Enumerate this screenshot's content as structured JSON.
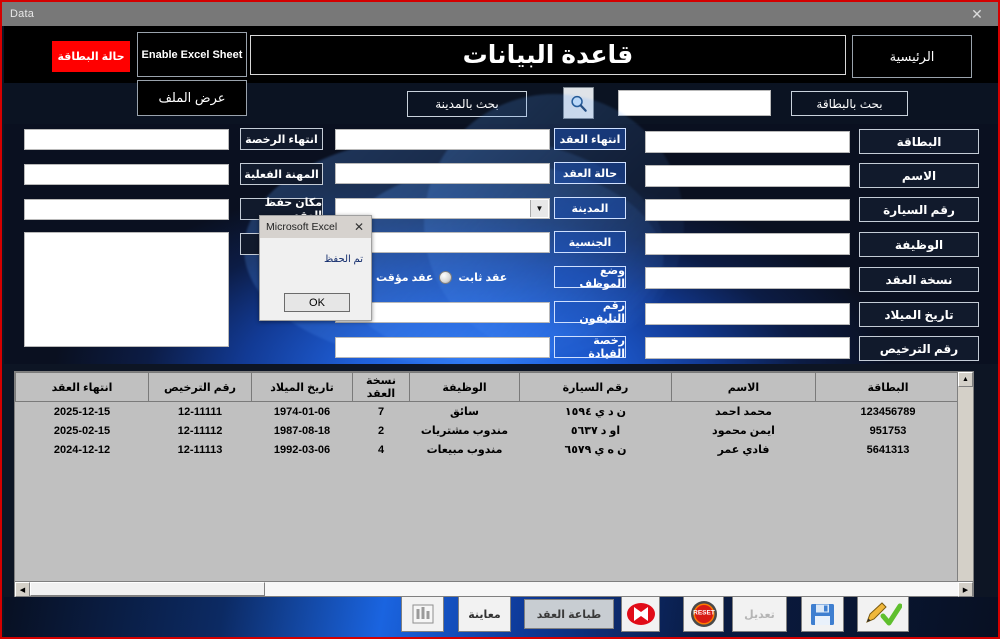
{
  "window": {
    "title": "Data",
    "close_icon": "close-icon"
  },
  "header": {
    "card_status_button": "حالة البطاقة",
    "enable_excel_button": "Enable Excel Sheet",
    "show_file_button": "عرض الملف",
    "app_title": "قاعدة البيانات",
    "home_button": "الرئيسية"
  },
  "search": {
    "search_by_city_button": "بحث بالمدينة",
    "magnifier_icon": "search-icon",
    "search_input_value": "",
    "search_input_placeholder": "",
    "search_by_card_button": "بحث بالبطاقة"
  },
  "form": {
    "right_labels": [
      "البطاقة",
      "الاسم",
      "رقم السيارة",
      "الوظيفة",
      "نسخة العقد",
      "تاريخ الميلاد",
      "رقم الترخيص"
    ],
    "right_values": [
      "",
      "",
      "",
      "",
      "",
      "",
      ""
    ],
    "middle_labels": [
      "انتهاء العقد",
      "حالة العقد",
      "المدينة",
      "الجنسية",
      "وضع الموظف",
      "رقم التليفون",
      "رخصة القيادة"
    ],
    "middle_values": [
      "",
      "",
      "",
      "",
      "",
      ""
    ],
    "city_combo_value": "",
    "employee_status": {
      "option_permanent": "عقد ثابت",
      "option_temporary": "عقد مؤقت",
      "selected": ""
    },
    "left_labels": [
      "انتهاء الرخصة",
      "المهنة الفعلية",
      "مكان حفظ العقد"
    ],
    "left_values": [
      "",
      "",
      ""
    ],
    "notes_value": ""
  },
  "grid": {
    "columns": [
      "انتهاء العقد",
      "رقم الترخيص",
      "تاريخ الميلاد",
      "نسخة العقد",
      "الوظيفة",
      "رقم السيارة",
      "الاسم",
      "البطاقة"
    ],
    "rows": [
      [
        "2025-12-15",
        "12-11111",
        "1974-01-06",
        "7",
        "سائق",
        "ن د ي ١٥٩٤",
        "محمد احمد",
        "123456789"
      ],
      [
        "2025-02-15",
        "12-11112",
        "1987-08-18",
        "2",
        "مندوب مشتريات",
        "او د ٥٦٣٧",
        "ايمن محمود",
        "951753"
      ],
      [
        "2024-12-12",
        "12-11113",
        "1992-03-06",
        "4",
        "مندوب مبيعات",
        "ن ه ي ٦٥٧٩",
        "فادي عمر",
        "5641313"
      ]
    ],
    "scroll_up_icon": "chevron-up-icon",
    "scroll_left_icon": "chevron-left-icon",
    "scroll_right_icon": "chevron-right-icon"
  },
  "toolbar": {
    "report_icon": "chart-report-icon",
    "preview_button": "معاينة",
    "print_contract_button": "طباعة العقد",
    "delete_icon": "delete-x-icon",
    "reset_icon": "reset-icon",
    "edit_button": "تعديل",
    "save_icon": "floppy-save-icon",
    "confirm_icon": "pencil-check-icon"
  },
  "dialog": {
    "title": "Microsoft Excel",
    "close_icon": "close-icon",
    "message": "تم الحفظ",
    "ok_button": "OK"
  },
  "colors": {
    "accent_red": "#ff0000",
    "window_border": "#d40000",
    "titlebar": "#787878",
    "panel_dark": "#0d1524",
    "grid_bg": "#c0c0c0"
  }
}
